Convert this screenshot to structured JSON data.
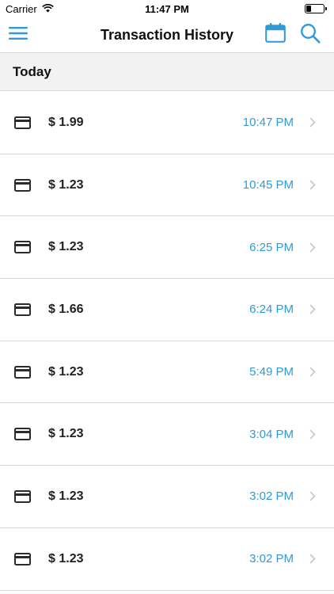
{
  "status_bar": {
    "carrier": "Carrier",
    "time": "11:47 PM",
    "battery_level": 0.35
  },
  "nav": {
    "title": "Transaction History",
    "menu_icon": "hamburger-icon",
    "calendar_icon": "calendar-icon",
    "search_icon": "search-icon"
  },
  "section": {
    "title": "Today"
  },
  "transactions": [
    {
      "amount": "$ 1.99",
      "time": "10:47 PM"
    },
    {
      "amount": "$ 1.23",
      "time": "10:45 PM"
    },
    {
      "amount": "$ 1.23",
      "time": "6:25 PM"
    },
    {
      "amount": "$ 1.66",
      "time": "6:24 PM"
    },
    {
      "amount": "$ 1.23",
      "time": "5:49 PM"
    },
    {
      "amount": "$ 1.23",
      "time": "3:04 PM"
    },
    {
      "amount": "$ 1.23",
      "time": "3:02 PM"
    },
    {
      "amount": "$ 1.23",
      "time": "3:02 PM"
    }
  ],
  "colors": {
    "accent": "#2f9ad6",
    "text": "#222222",
    "section_bg": "#f2f2f2",
    "divider": "#d6d6d6"
  }
}
